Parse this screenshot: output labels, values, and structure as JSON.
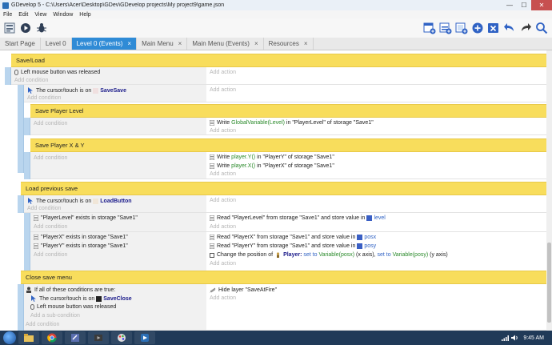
{
  "window": {
    "title": "GDevelop 5 - C:\\Users\\Acer\\Desktop\\GDev\\GDevelop projects\\My project9\\game.json",
    "minimize": "—",
    "maximize": "☐",
    "close": "✕"
  },
  "menu": [
    "File",
    "Edit",
    "View",
    "Window",
    "Help"
  ],
  "tabs": [
    {
      "label": "Start Page",
      "closable": false,
      "active": false
    },
    {
      "label": "Level 0",
      "closable": false,
      "active": false
    },
    {
      "label": "Level 0 (Events)",
      "closable": true,
      "active": true
    },
    {
      "label": "Main Menu",
      "closable": true,
      "active": false
    },
    {
      "label": "Main Menu (Events)",
      "closable": true,
      "active": false
    },
    {
      "label": "Resources",
      "closable": true,
      "active": false
    }
  ],
  "close_glyph": "×",
  "events": {
    "add_action": "Add action",
    "add_condition": "Add condition",
    "add_subcondition": "Add a sub-condition",
    "save_group": "Save/Load",
    "e1_cond": "Left mouse button was released",
    "e2_cond_prefix": "The cursor/touch is on",
    "e2_cond_obj": "SaveSave",
    "g_save_level": "Save Player Level",
    "a_write_level_pre": "Write",
    "a_write_level_gv": "GlobalVariable(Level)",
    "a_write_level_post": "in \"PlayerLevel\" of storage \"Save1\"",
    "g_save_xy": "Save Player X & Y",
    "a_write_y_pre": "Write",
    "a_write_y_expr": "player.Y()",
    "a_write_y_post": "in \"PlayerY\" of storage \"Save1\"",
    "a_write_x_pre": "Write",
    "a_write_x_expr": "player.X()",
    "a_write_x_post": "in \"PlayerX\" of storage \"Save1\"",
    "g_load_prev": "Load previous save",
    "e3_cond_prefix": "The cursor/touch is on",
    "e3_cond_obj": "LoadButton",
    "c_exists_level": "\"PlayerLevel\" exists in storage \"Save1\"",
    "a_read_level": "Read \"PlayerLevel\" from storage \"Save1\" and store value in",
    "a_read_level_var": "level",
    "c_exists_x": "\"PlayerX\" exists in storage \"Save1\"",
    "c_exists_y": "\"PlayerY\" exists in storage \"Save1\"",
    "a_read_x": "Read \"PlayerX\" from storage \"Save1\" and store value in",
    "a_read_x_var": "posx",
    "a_read_y": "Read \"PlayerY\" from storage \"Save1\" and store value in",
    "a_read_y_var": "posy",
    "a_change_pos_pre": "Change the position of",
    "a_change_pos_obj": "Player:",
    "a_change_pos_set1": "set to",
    "a_change_pos_var1": "Variable(posx)",
    "a_change_pos_mid": "(x axis),",
    "a_change_pos_set2": "set to",
    "a_change_pos_var2": "Variable(posy)",
    "a_change_pos_end": "(y axis)",
    "g_close_save": "Close save menu",
    "e4_cond_all": "If all of these conditions are true:",
    "e4_sub1_prefix": "The cursor/touch is on",
    "e4_sub1_obj": "SaveClose",
    "e4_sub2": "Left mouse button was released",
    "a_hide_layer": "Hide layer \"SaveAtFire\""
  },
  "tray": {
    "time": "9:45 AM"
  },
  "colors": {
    "accent": "#2f8bd6",
    "group": "#f8dd5c",
    "stripe": "#b9d5ee"
  }
}
